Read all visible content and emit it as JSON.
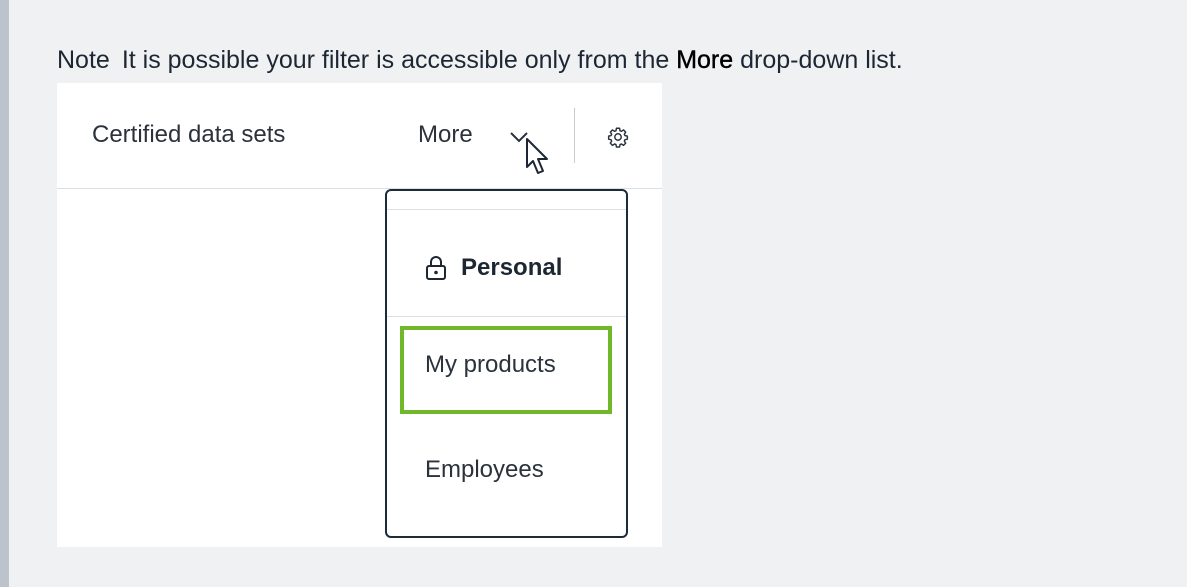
{
  "note": {
    "label": "Note",
    "text_before": "It is possible your filter is accessible only from the ",
    "emphasis": "More",
    "text_after": " drop-down list."
  },
  "tabs": {
    "certified_label": "Certified data sets",
    "more_label": "More"
  },
  "icons": {
    "chevron": "chevron-down-icon",
    "cursor": "mouse-pointer-icon",
    "settings": "gear-icon",
    "lock": "lock-icon"
  },
  "dropdown": {
    "section_header": "Personal",
    "items": [
      {
        "label": "My products",
        "highlighted": true
      },
      {
        "label": "Employees",
        "highlighted": false
      }
    ]
  },
  "colors": {
    "highlight": "#6fb82a",
    "dropdown_border": "#1c2b3a",
    "note_bar": "#bcc3cc",
    "page_bg": "#f0f1f3"
  }
}
